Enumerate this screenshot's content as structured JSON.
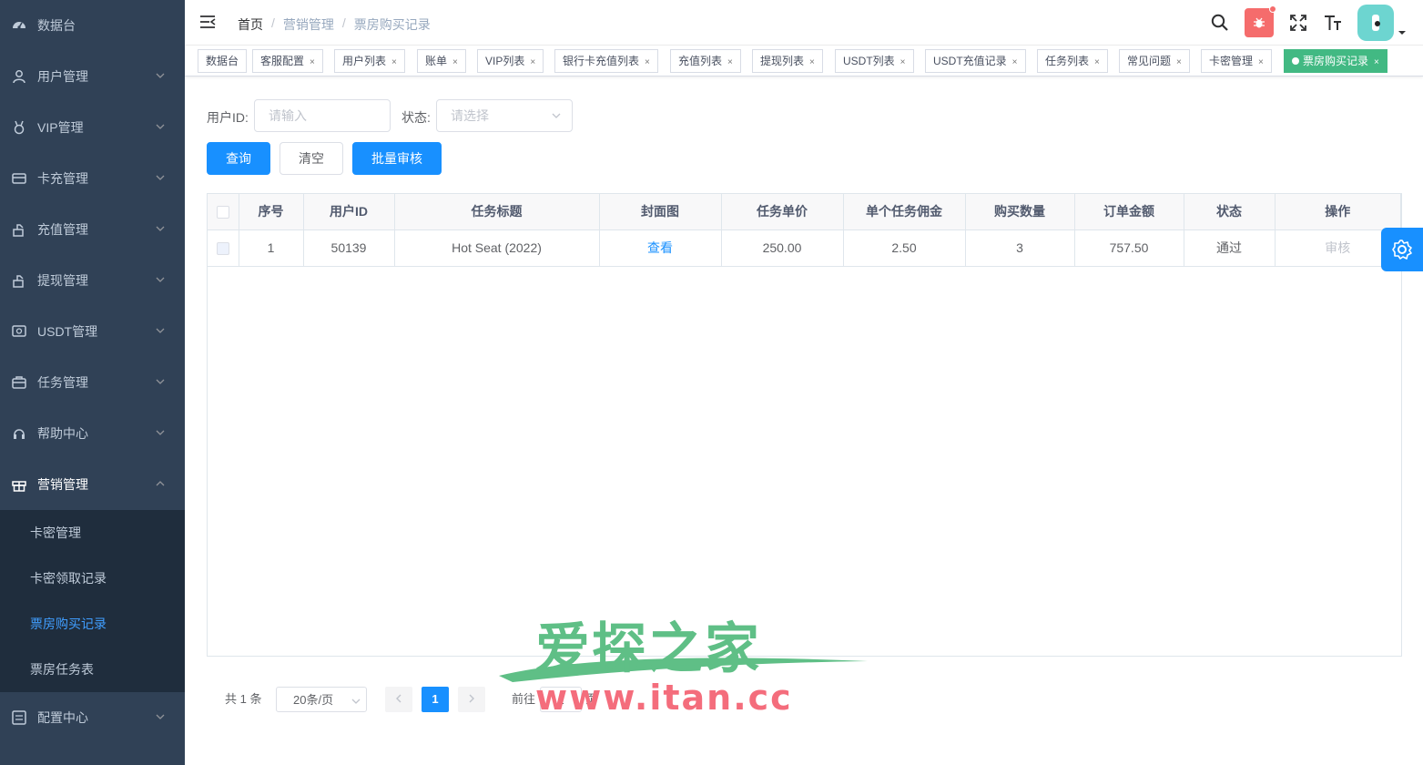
{
  "sidebar": {
    "items": [
      {
        "label": "数据台",
        "icon": "dashboard-icon"
      },
      {
        "label": "用户管理",
        "icon": "user-icon"
      },
      {
        "label": "VIP管理",
        "icon": "medal-icon"
      },
      {
        "label": "卡充管理",
        "icon": "card-icon"
      },
      {
        "label": "充值管理",
        "icon": "recharge-icon"
      },
      {
        "label": "提现管理",
        "icon": "withdraw-icon"
      },
      {
        "label": "USDT管理",
        "icon": "usdt-icon"
      },
      {
        "label": "任务管理",
        "icon": "briefcase-icon"
      },
      {
        "label": "帮助中心",
        "icon": "help-icon"
      },
      {
        "label": "营销管理",
        "icon": "gift-icon"
      }
    ],
    "submenu": [
      "卡密管理",
      "卡密领取记录",
      "票房购买记录",
      "票房任务表"
    ],
    "after": {
      "label": "配置中心",
      "icon": "config-icon"
    }
  },
  "breadcrumb": [
    "首页",
    "营销管理",
    "票房购买记录"
  ],
  "tags": [
    "数据台",
    "客服配置",
    "用户列表",
    "账单",
    "VIP列表",
    "银行卡充值列表",
    "充值列表",
    "提现列表",
    "USDT列表",
    "USDT充值记录",
    "任务列表",
    "常见问题",
    "卡密管理",
    "票房购买记录"
  ],
  "tag_close": "×",
  "filters": {
    "user_id_label": "用户ID:",
    "user_id_placeholder": "请输入",
    "status_label": "状态:",
    "status_placeholder": "请选择"
  },
  "buttons": {
    "query": "查询",
    "clear": "清空",
    "batch": "批量审核"
  },
  "table": {
    "headers": [
      "序号",
      "用户ID",
      "任务标题",
      "封面图",
      "任务单价",
      "单个任务佣金",
      "购买数量",
      "订单金额",
      "状态",
      "操作"
    ],
    "rows": [
      {
        "no": "1",
        "user_id": "50139",
        "title": "Hot Seat (2022)",
        "cover": "查看",
        "price": "250.00",
        "commission": "2.50",
        "qty": "3",
        "amount": "757.50",
        "status": "通过",
        "action": "审核"
      }
    ]
  },
  "pagination": {
    "total": "共 1 条",
    "size": "20条/页",
    "page": "1",
    "goto": "前往",
    "goto_value": "1",
    "page_unit": "页"
  },
  "watermark": {
    "cn": "爱探之家",
    "url": "www.itan.cc"
  },
  "colors": {
    "sidebar_bg": "#304156",
    "submenu_bg": "#1f2d3d",
    "primary": "#1890ff",
    "active_tag": "#42b983",
    "danger": "#f56c6c"
  }
}
